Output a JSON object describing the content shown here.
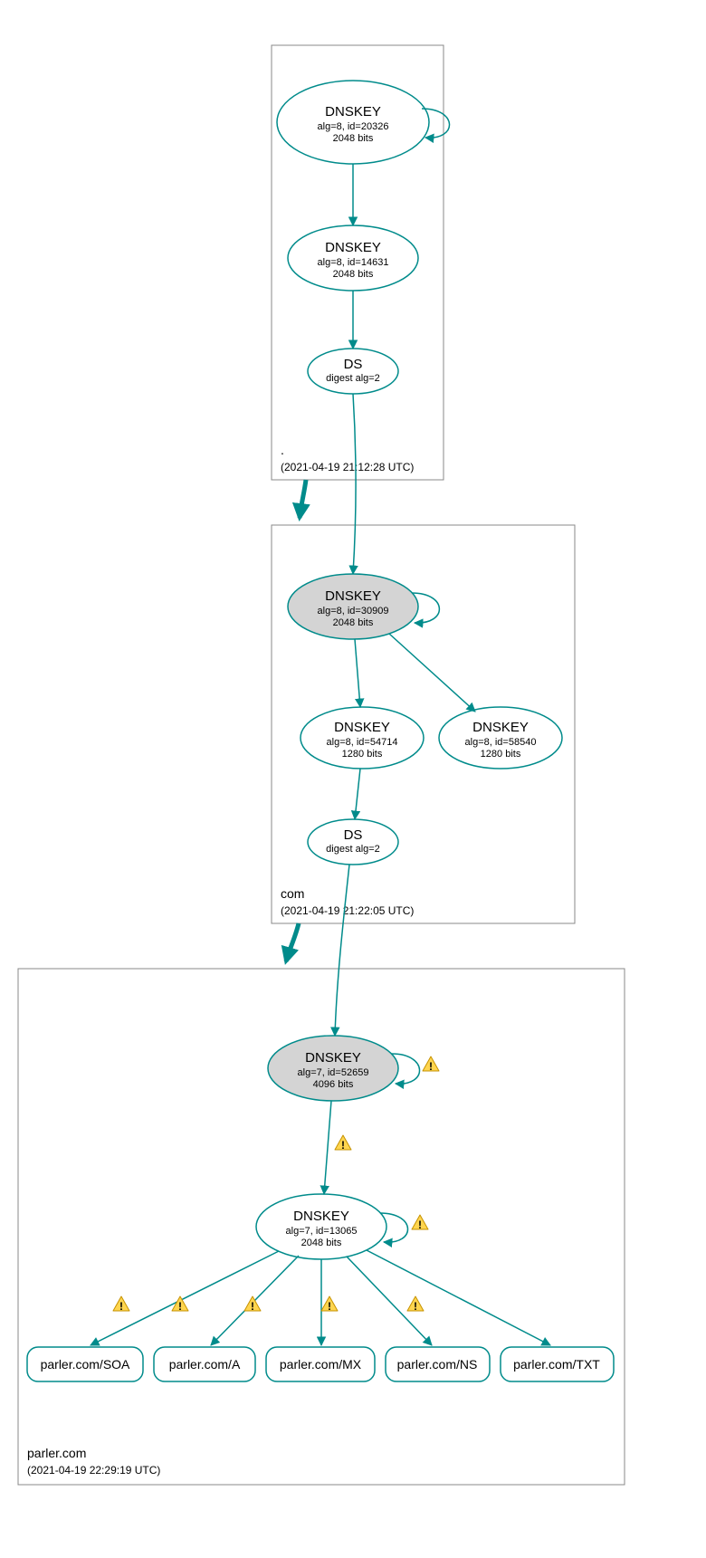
{
  "colors": {
    "stroke": "#008B8B",
    "shaded": "#d4d4d4",
    "warn_fill": "#FFD54F",
    "warn_stroke": "#C69200"
  },
  "zones": {
    "root": {
      "label": ".",
      "timestamp": "(2021-04-19 21:12:28 UTC)",
      "nodes": {
        "ksk": {
          "title": "DNSKEY",
          "line2": "alg=8, id=20326",
          "line3": "2048 bits",
          "shaded": true,
          "double": true
        },
        "zsk": {
          "title": "DNSKEY",
          "line2": "alg=8, id=14631",
          "line3": "2048 bits",
          "shaded": false,
          "double": false
        },
        "ds": {
          "title": "DS",
          "line2": "digest alg=2"
        }
      }
    },
    "com": {
      "label": "com",
      "timestamp": "(2021-04-19 21:22:05 UTC)",
      "nodes": {
        "ksk": {
          "title": "DNSKEY",
          "line2": "alg=8, id=30909",
          "line3": "2048 bits",
          "shaded": true
        },
        "zsk": {
          "title": "DNSKEY",
          "line2": "alg=8, id=54714",
          "line3": "1280 bits"
        },
        "zsk2": {
          "title": "DNSKEY",
          "line2": "alg=8, id=58540",
          "line3": "1280 bits"
        },
        "ds": {
          "title": "DS",
          "line2": "digest alg=2"
        }
      }
    },
    "parler": {
      "label": "parler.com",
      "timestamp": "(2021-04-19 22:29:19 UTC)",
      "nodes": {
        "ksk": {
          "title": "DNSKEY",
          "line2": "alg=7, id=52659",
          "line3": "4096 bits",
          "shaded": true
        },
        "zsk": {
          "title": "DNSKEY",
          "line2": "alg=7, id=13065",
          "line3": "2048 bits"
        }
      },
      "records": {
        "soa": "parler.com/SOA",
        "a": "parler.com/A",
        "mx": "parler.com/MX",
        "ns": "parler.com/NS",
        "txt": "parler.com/TXT"
      }
    }
  }
}
